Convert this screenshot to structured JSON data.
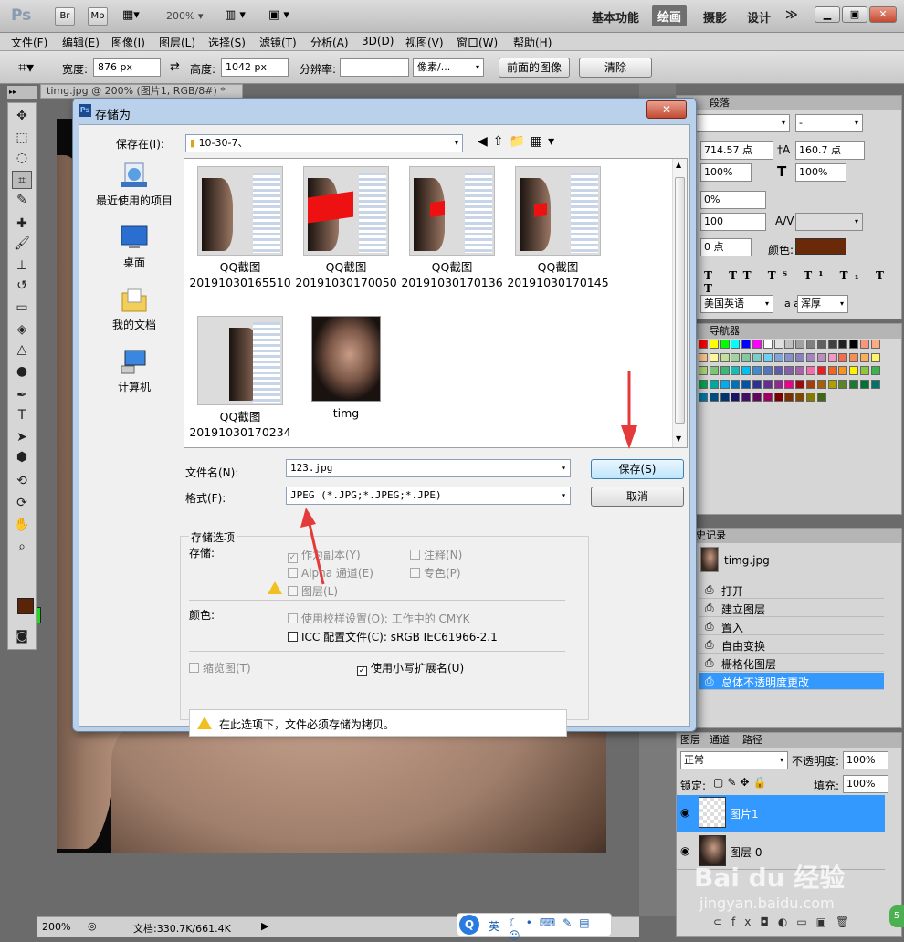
{
  "app": {
    "logo": "Ps",
    "toolbar_badges": [
      "Br",
      "Mb"
    ],
    "zoom": "200%",
    "workspaces": [
      "基本功能",
      "绘画",
      "摄影",
      "设计"
    ],
    "active_workspace": "绘画",
    "more": "≫"
  },
  "menu": [
    "文件(F)",
    "编辑(E)",
    "图像(I)",
    "图层(L)",
    "选择(S)",
    "滤镜(T)",
    "分析(A)",
    "3D(D)",
    "视图(V)",
    "窗口(W)",
    "帮助(H)"
  ],
  "options": {
    "width_label": "宽度:",
    "width_value": "876 px",
    "height_label": "高度:",
    "height_value": "1042 px",
    "res_label": "分辨率:",
    "res_value": "",
    "unit": "像素/...",
    "front_image": "前面的图像",
    "clear": "清除"
  },
  "document": {
    "tab": "timg.jpg @ 200% (图片1, RGB/8#) *",
    "status_zoom": "200%",
    "status_doc": "文档:330.7K/661.4K"
  },
  "char_panel": {
    "tab": "段落",
    "font_style": "-",
    "size": "714.57 点",
    "leading": "160.7 点",
    "vscale": "100%",
    "hscale": "100%",
    "tracking": "0%",
    "kerning": "100",
    "baseline": "0 点",
    "color_label": "颜色:",
    "color": "#6a2a0a",
    "lang": "美国英语",
    "aa_label": "a a",
    "aa_value": "浑厚",
    "style_buttons": [
      "T",
      "T",
      "TT",
      "Tr",
      "T¹",
      "T₁",
      "T",
      "T"
    ]
  },
  "swatch_panel": {
    "tab": "导航器"
  },
  "history_panel": {
    "tab": "历史记录",
    "snapshot": "timg.jpg",
    "items": [
      "打开",
      "建立图层",
      "置入",
      "自由变换",
      "栅格化图层",
      "总体不透明度更改"
    ],
    "active": "总体不透明度更改"
  },
  "layers_panel": {
    "tabs": [
      "图层",
      "通道",
      "路径"
    ],
    "blend": "正常",
    "opacity_label": "不透明度:",
    "opacity": "100%",
    "lock_label": "锁定:",
    "fill_label": "填充:",
    "fill": "100%",
    "layers": [
      "图片1",
      "图层 0"
    ]
  },
  "dialog": {
    "title": "存储为",
    "close": "✕",
    "save_in_label": "保存在(I):",
    "save_in_value": "10-30-7、",
    "places": [
      "最近使用的项目",
      "桌面",
      "我的文档",
      "计算机"
    ],
    "files": [
      {
        "name": "QQ截图",
        "date": "20191030165510"
      },
      {
        "name": "QQ截图",
        "date": "20191030170050"
      },
      {
        "name": "QQ截图",
        "date": "20191030170136"
      },
      {
        "name": "QQ截图",
        "date": "20191030170145"
      },
      {
        "name": "QQ截图",
        "date": "20191030170234"
      },
      {
        "name": "timg",
        "date": ""
      }
    ],
    "filename_label": "文件名(N):",
    "filename_value": "123.jpg",
    "format_label": "格式(F):",
    "format_value": "JPEG (*.JPG;*.JPEG;*.JPE)",
    "save_button": "保存(S)",
    "cancel_button": "取消",
    "options_title": "存储选项",
    "storage_label": "存储:",
    "opt_copy": "作为副本(Y)",
    "opt_notes": "注释(N)",
    "opt_alpha": "Alpha 通道(E)",
    "opt_spot": "专色(P)",
    "opt_layers": "图层(L)",
    "color_label": "颜色:",
    "opt_proof": "使用校样设置(O):",
    "proof_value": "工作中的 CMYK",
    "opt_icc": "ICC 配置文件(C):",
    "icc_value": "sRGB IEC61966-2.1",
    "opt_thumb": "缩览图(T)",
    "opt_lower": "使用小写扩展名(U)",
    "warning": "在此选项下，文件必须存储为拷贝。"
  },
  "taskbar": {
    "ime": "英",
    "watermark1": "Bai du 经验",
    "watermark2": "jingyan.baidu.com",
    "corner_badge": "5"
  }
}
